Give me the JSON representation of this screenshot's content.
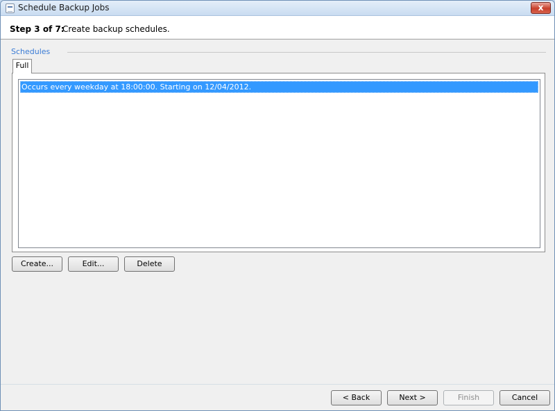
{
  "window": {
    "title": "Schedule Backup Jobs",
    "close_glyph": "x"
  },
  "header": {
    "step_label": "Step 3 of 7:",
    "step_description": "Create backup schedules."
  },
  "schedules": {
    "group_label": "Schedules",
    "tabs": [
      {
        "label": "Full",
        "selected": true
      }
    ],
    "items": [
      {
        "text": "Occurs every weekday at 18:00:00. Starting on 12/04/2012.",
        "selected": true
      }
    ],
    "buttons": {
      "create": "Create...",
      "edit": "Edit...",
      "delete": "Delete"
    }
  },
  "footer": {
    "back": "< Back",
    "next": "Next >",
    "finish": "Finish",
    "finish_enabled": false,
    "cancel": "Cancel"
  },
  "colors": {
    "accent": "#3399ff",
    "group_label": "#3a7bd5",
    "close_button": "#c8402c"
  }
}
